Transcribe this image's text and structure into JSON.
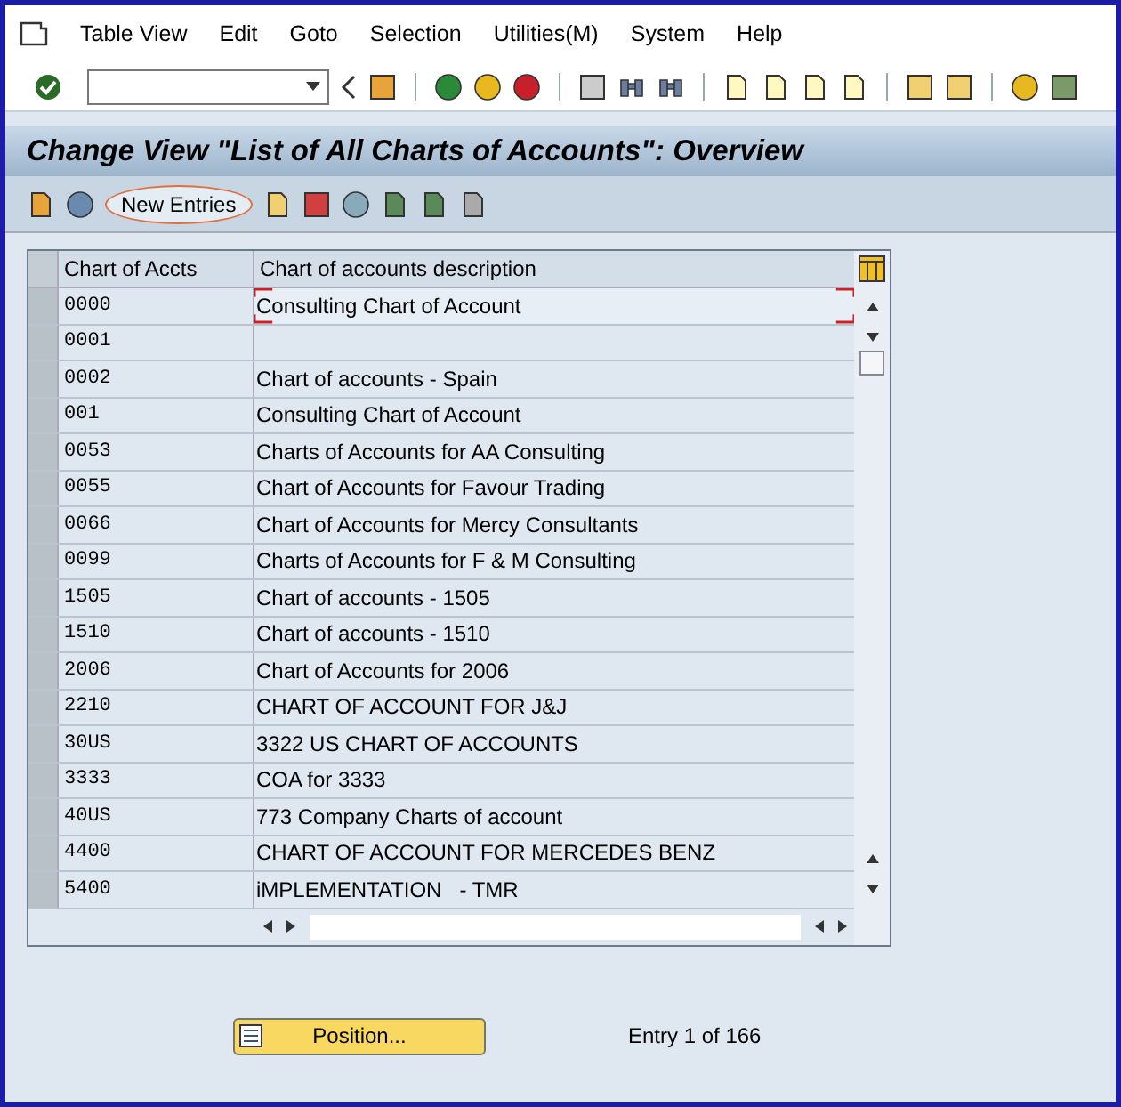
{
  "menu": [
    "Table View",
    "Edit",
    "Goto",
    "Selection",
    "Utilities(M)",
    "System",
    "Help"
  ],
  "title": "Change View \"List of All Charts of Accounts\": Overview",
  "app_toolbar": {
    "new_entries": {
      "label": "New Entries",
      "highlighted": true
    }
  },
  "table": {
    "columns": [
      "Chart of Accts",
      "Chart of accounts description"
    ],
    "rows": [
      {
        "code": "0000",
        "description": "Consulting Chart of Account",
        "focused": true
      },
      {
        "code": "0001",
        "description": "",
        "focused": false
      },
      {
        "code": "0002",
        "description": "Chart of accounts - Spain",
        "focused": false
      },
      {
        "code": "001",
        "description": "Consulting Chart of Account",
        "focused": false
      },
      {
        "code": "0053",
        "description": "Charts of Accounts for AA Consulting",
        "focused": false
      },
      {
        "code": "0055",
        "description": "Chart of Accounts for Favour Trading",
        "focused": false
      },
      {
        "code": "0066",
        "description": "Chart of Accounts for Mercy Consultants",
        "focused": false
      },
      {
        "code": "0099",
        "description": "Charts of Accounts for F & M Consulting",
        "focused": false
      },
      {
        "code": "1505",
        "description": "Chart of accounts - 1505",
        "focused": false
      },
      {
        "code": "1510",
        "description": "Chart of accounts - 1510",
        "focused": false
      },
      {
        "code": "2006",
        "description": "Chart of Accounts for 2006",
        "focused": false
      },
      {
        "code": "2210",
        "description": "CHART OF ACCOUNT FOR J&J",
        "focused": false
      },
      {
        "code": "30US",
        "description": "3322 US CHART OF ACCOUNTS",
        "focused": false
      },
      {
        "code": "3333",
        "description": "COA for 3333",
        "focused": false
      },
      {
        "code": "40US",
        "description": "773 Company Charts of account",
        "focused": false
      },
      {
        "code": "4400",
        "description": "CHART OF ACCOUNT FOR MERCEDES BENZ",
        "focused": false
      },
      {
        "code": "5400",
        "description": "iMPLEMENTATION   - TMR",
        "focused": false
      }
    ]
  },
  "position_button": "Position...",
  "entry_info": "Entry 1 of 166"
}
